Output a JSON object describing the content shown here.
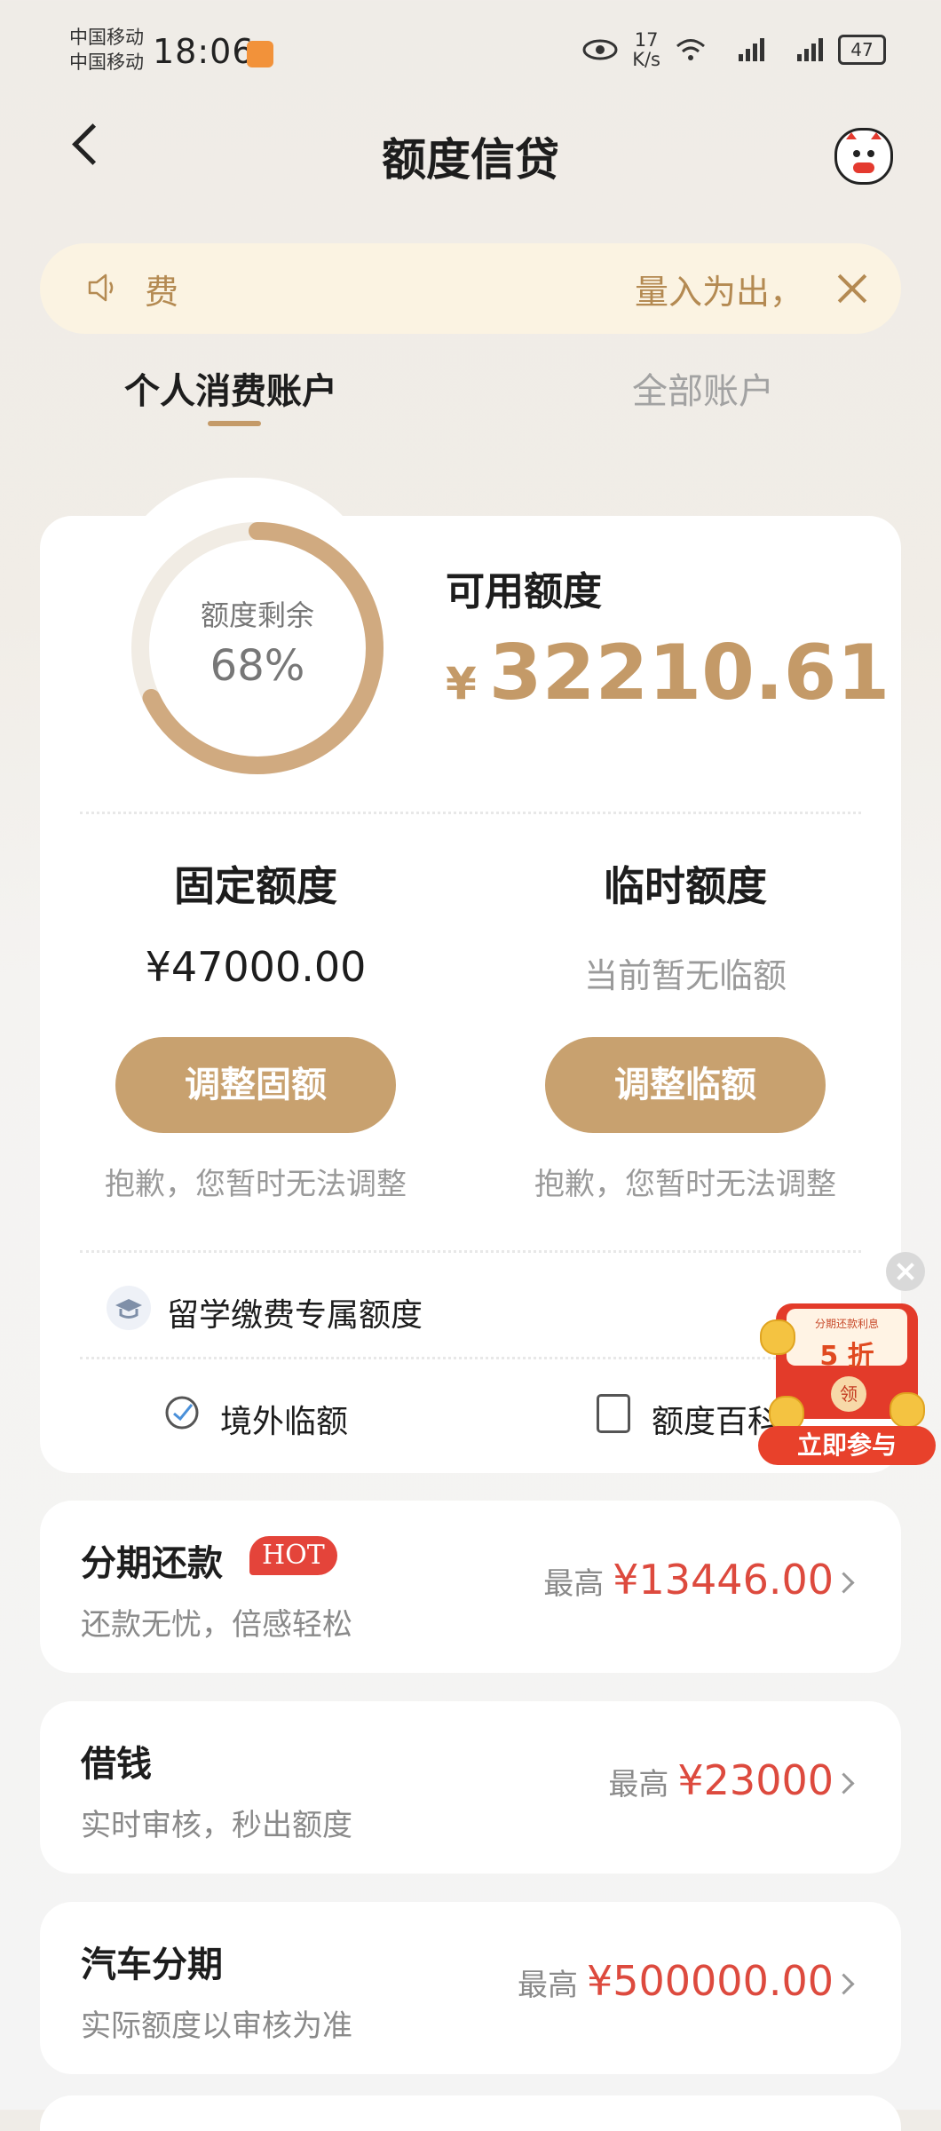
{
  "status_bar": {
    "carrier1": "中国移动",
    "carrier2": "中国移动",
    "time": "18:06",
    "speed_value": "17",
    "speed_unit": "K/s",
    "battery": "47"
  },
  "nav": {
    "title": "额度信贷"
  },
  "notice": {
    "text_left": "费",
    "text_right": "量入为出，"
  },
  "tabs": [
    {
      "label": "个人消费账户",
      "active": true
    },
    {
      "label": "全部账户",
      "active": false
    }
  ],
  "credit": {
    "ring_label": "额度剩余",
    "ring_percent_text": "68%",
    "remaining_fraction": 0.68,
    "available_title": "可用额度",
    "currency": "¥",
    "available_amount": "32210.61",
    "fixed": {
      "title": "固定额度",
      "amount": "¥47000.00",
      "button": "调整固额",
      "note": "抱歉，您暂时无法调整"
    },
    "temporary": {
      "title": "临时额度",
      "amount": "当前暂无临额",
      "button": "调整临额",
      "note": "抱歉，您暂时无法调整"
    },
    "study_quota": "留学缴费专属额度",
    "links": {
      "overseas": "境外临额",
      "wiki": "额度百科"
    }
  },
  "promo": {
    "small_text": "分期还款利息",
    "big_text": "5 折",
    "seal": "领",
    "button": "立即参与"
  },
  "products": [
    {
      "name": "分期还款",
      "badge": "HOT",
      "subtitle": "还款无忧，倍感轻松",
      "label": "最高",
      "amount": "¥13446.00"
    },
    {
      "name": "借钱",
      "badge": "",
      "subtitle": "实时审核，秒出额度",
      "label": "最高",
      "amount": "¥23000"
    },
    {
      "name": "汽车分期",
      "badge": "",
      "subtitle": "实际额度以审核为准",
      "label": "最高",
      "amount": "¥500000.00"
    }
  ],
  "colors": {
    "accent": "#c49a68",
    "button": "#c8a16f",
    "price_red": "#dd4a3e",
    "hot_red": "#e4443a"
  }
}
